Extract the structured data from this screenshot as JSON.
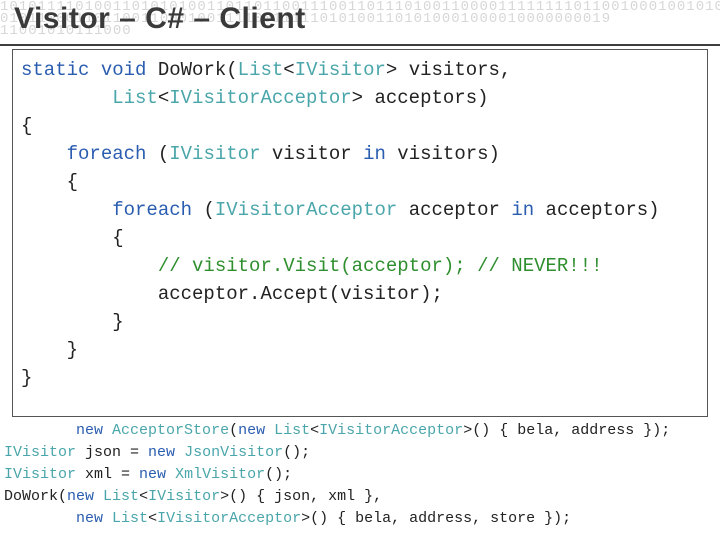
{
  "background_binary": {
    "line1": "10101111010011010101001101101100111001101110100110000111111110110010001001010",
    "line2": "01011000110110011000100111100111110101001101010001000010000000019",
    "line3": "11001010111000"
  },
  "title": "Visitor – C# – Client",
  "code1": {
    "l1_a": "static",
    "l1_b": " void ",
    "l1_c": "DoWork",
    "l1_d": "(",
    "l1_e": "List",
    "l1_f": "<",
    "l1_g": "IVisitor",
    "l1_h": "> visitors,",
    "l2_a": "        ",
    "l2_b": "List",
    "l2_c": "<",
    "l2_d": "IVisitorAcceptor",
    "l2_e": "> acceptors)",
    "l3": "{",
    "l4_a": "    ",
    "l4_b": "foreach",
    "l4_c": " (",
    "l4_d": "IVisitor",
    "l4_e": " visitor ",
    "l4_f": "in",
    "l4_g": " visitors)",
    "l5": "    {",
    "l6_a": "        ",
    "l6_b": "foreach",
    "l6_c": " (",
    "l6_d": "IVisitorAcceptor",
    "l6_e": " acceptor ",
    "l6_f": "in",
    "l6_g": " acceptors)",
    "l7": "        {",
    "l8_a": "            ",
    "l8_b": "// visitor.Visit(acceptor); // NEVER!!!",
    "l9": "            acceptor.Accept(visitor);",
    "l10": "        }",
    "l11": "    }",
    "l12": "}"
  },
  "code2": {
    "l1_a": "        ",
    "l1_b": "new",
    "l1_c": " ",
    "l1_d": "AcceptorStore",
    "l1_e": "(",
    "l1_f": "new",
    "l1_g": " ",
    "l1_h": "List",
    "l1_i": "<",
    "l1_j": "IVisitorAcceptor",
    "l1_k": ">() { bela, address });",
    "l2_a": "IVisitor",
    "l2_b": " json = ",
    "l2_c": "new",
    "l2_d": " ",
    "l2_e": "JsonVisitor",
    "l2_f": "();",
    "l3_a": "IVisitor",
    "l3_b": " xml = ",
    "l3_c": "new",
    "l3_d": " ",
    "l3_e": "XmlVisitor",
    "l3_f": "();",
    "l4_a": "DoWork(",
    "l4_b": "new",
    "l4_c": " ",
    "l4_d": "List",
    "l4_e": "<",
    "l4_f": "IVisitor",
    "l4_g": ">() { json, xml },",
    "l5_a": "        ",
    "l5_b": "new",
    "l5_c": " ",
    "l5_d": "List",
    "l5_e": "<",
    "l5_f": "IVisitorAcceptor",
    "l5_g": ">() { bela, address, store });"
  }
}
